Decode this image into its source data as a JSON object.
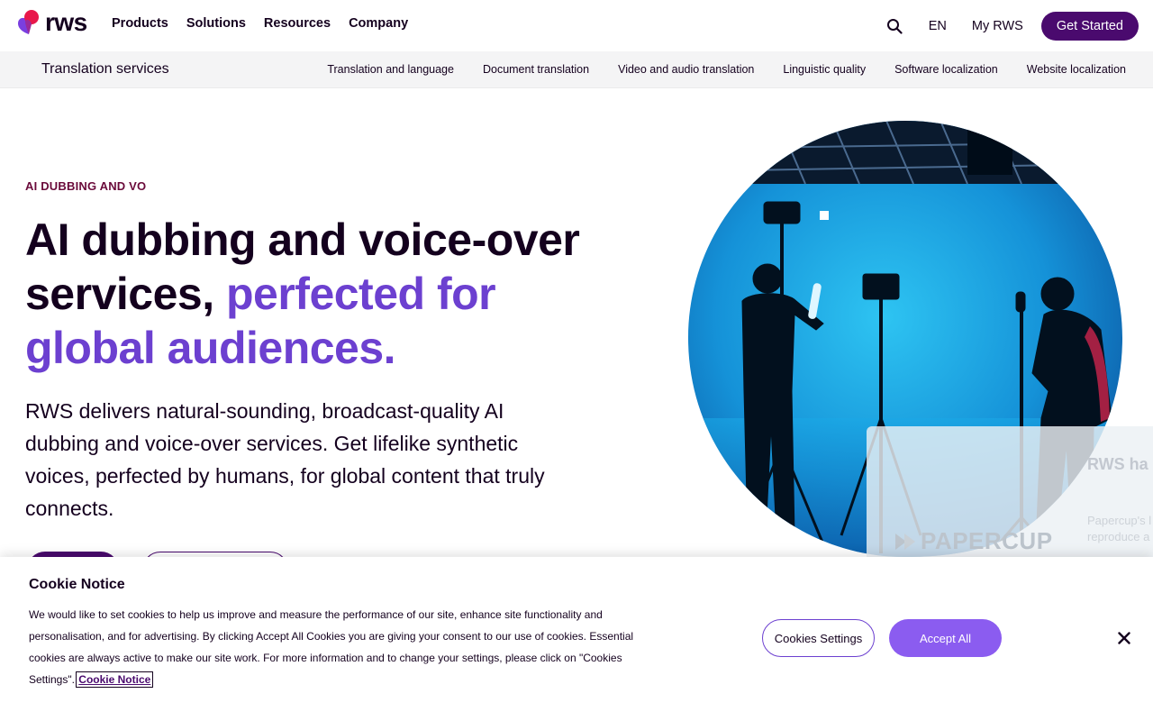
{
  "brand": {
    "name": "rws",
    "logo_colors": {
      "red": "#e8174a",
      "purple": "#7a3fe0"
    }
  },
  "topnav": {
    "menu": [
      "Products",
      "Solutions",
      "Resources",
      "Company"
    ],
    "language": "EN",
    "account": "My RWS",
    "cta": "Get Started",
    "search_icon": "search-icon"
  },
  "subnav": {
    "title": "Translation services",
    "links": [
      "Translation and language",
      "Document translation",
      "Video and audio translation",
      "Linguistic quality",
      "Software localization",
      "Website localization"
    ]
  },
  "hero": {
    "eyebrow": "AI DUBBING AND VO",
    "headline_plain": "AI dubbing and voice-over services, ",
    "headline_accent": "perfected for global audiences.",
    "lead": "RWS delivers natural-sounding, broadcast-quality AI dubbing and voice-over services. Get lifelike synthetic voices, perfected by humans, for global content that truly connects."
  },
  "promo": {
    "logo": "PAPERCUP",
    "title": "RWS ha Papercu",
    "text": "Papercup's l technology, reproduce a"
  },
  "cookie": {
    "title": "Cookie Notice",
    "body": "We would like to set cookies to help us improve and measure the performance of our site, enhance site functionality and personalisation, and for advertising. By clicking Accept All Cookies you are giving your consent to our use of cookies. Essential cookies are always active to make our site work. For more information and to change your settings, please click on \"Cookies Settings\". ",
    "link": "Cookie Notice",
    "settings_button": "Cookies Settings",
    "accept_button": "Accept All",
    "close_icon": "close-icon"
  },
  "colors": {
    "primary": "#4a0a6e",
    "accent": "#6c40d0",
    "accept": "#8b5cf0",
    "eyebrow": "#6a0a3a"
  }
}
